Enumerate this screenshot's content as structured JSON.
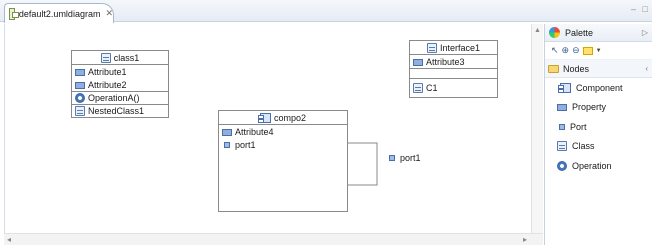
{
  "editor": {
    "tab_label": "default2.umldiagram",
    "tab_close": "✕",
    "window_controls": "– □"
  },
  "diagram": {
    "class1": {
      "name": "class1",
      "attributes": [
        "Attribute1",
        "Attribute2"
      ],
      "operations": [
        "OperationA()"
      ],
      "nested": [
        "NestedClass1"
      ]
    },
    "interface1": {
      "name": "Interface1",
      "attributes": [
        "Attribute3"
      ],
      "nested": [
        "C1"
      ]
    },
    "compo2": {
      "name": "compo2",
      "attributes": [
        "Attribute4"
      ],
      "ports": [
        "port1"
      ]
    },
    "external_port": "port1"
  },
  "palette": {
    "title": "Palette",
    "drawer": "Nodes",
    "entries": [
      {
        "label": "Component",
        "icon": "component-icon"
      },
      {
        "label": "Property",
        "icon": "property-icon"
      },
      {
        "label": "Port",
        "icon": "port-icon"
      },
      {
        "label": "Class",
        "icon": "class-icon"
      },
      {
        "label": "Operation",
        "icon": "operation-icon"
      }
    ]
  }
}
